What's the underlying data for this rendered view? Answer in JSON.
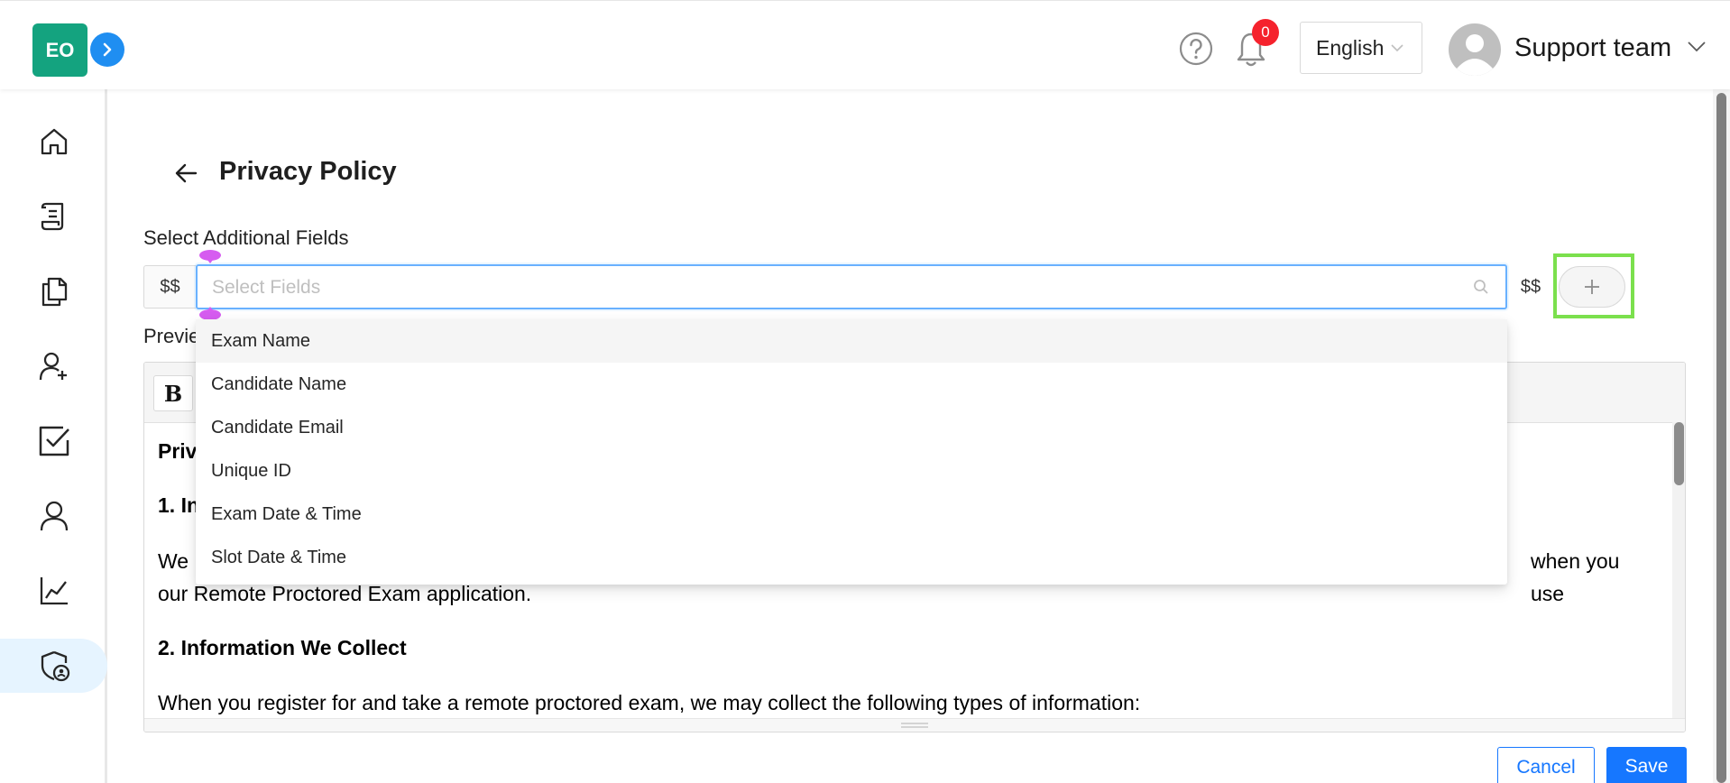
{
  "header": {
    "logo_text": "EO",
    "notification_count": "0",
    "language": "English",
    "user_name": "Support team",
    "icons": [
      "expand-sidebar-icon",
      "help-icon",
      "bell-icon",
      "user-avatar-icon",
      "chevron-down-icon"
    ]
  },
  "sidebar": {
    "items": [
      {
        "icon": "home-icon"
      },
      {
        "icon": "scroll-icon"
      },
      {
        "icon": "documents-icon"
      },
      {
        "icon": "add-user-icon"
      },
      {
        "icon": "checkbox-icon"
      },
      {
        "icon": "user-icon"
      },
      {
        "icon": "chart-icon"
      },
      {
        "icon": "shield-user-icon",
        "active": true
      }
    ]
  },
  "page": {
    "title": "Privacy Policy",
    "fields_label": "Select Additional Fields",
    "addon_before": "$$",
    "addon_after": "$$",
    "select_placeholder": "Select Fields",
    "preview_label": "Previe",
    "dropdown_options": [
      "Exam Name",
      "Candidate Name",
      "Candidate Email",
      "Unique ID",
      "Exam Date & Time",
      "Slot Date & Time"
    ],
    "editor": {
      "bold_label": "B",
      "heading_fragment": "Priv",
      "section1_fragment": "1. In",
      "para1_start": "We",
      "para1_end": "when you use",
      "para1_line2": "our Remote Proctored Exam application.",
      "section2_heading": "2. Information We Collect",
      "para2": "When you register for and take a remote proctored exam, we may collect the following types of information:"
    },
    "cancel_label": "Cancel",
    "save_label": "Save"
  },
  "colors": {
    "brand_green": "#14a37f",
    "primary_blue": "#1677ff",
    "badge_red": "#f5222d",
    "highlight_green": "#7be04d"
  }
}
